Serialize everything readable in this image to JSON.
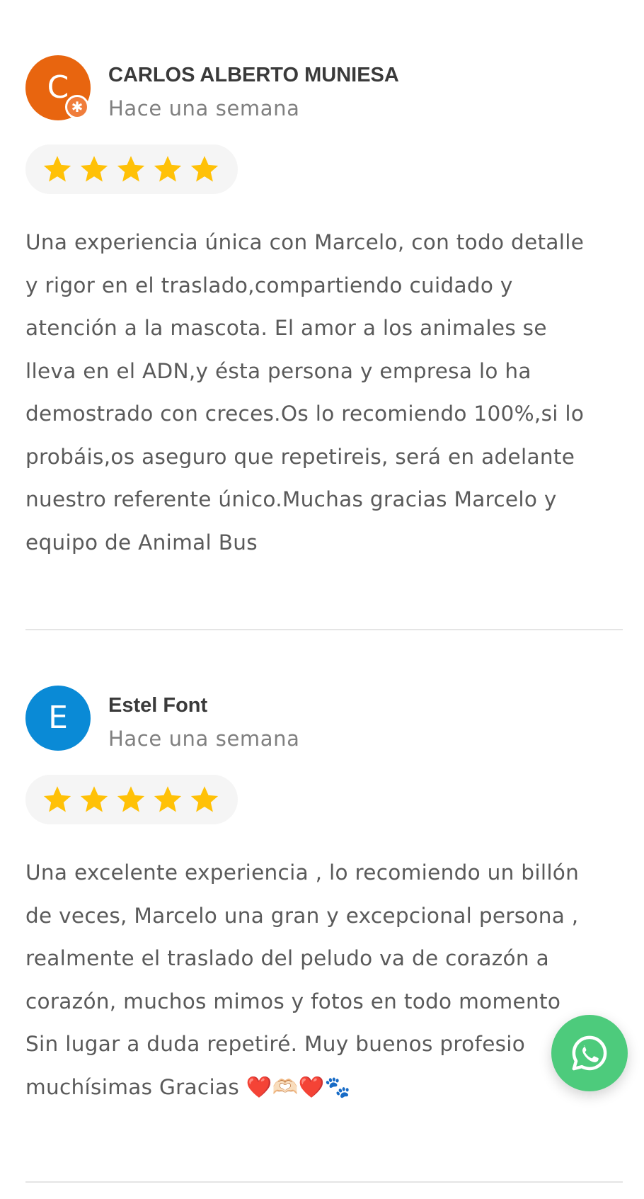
{
  "reviews": [
    {
      "avatar_letter": "C",
      "avatar_color": "#e8650f",
      "badge_symbol": "✱",
      "name": "CARLOS ALBERTO MUNIESA",
      "time": "Hace una semana",
      "rating": 5,
      "text": "Una experiencia única con Marcelo, con todo detalle\ny rigor en el traslado,compartiendo cuidado y\natención a la mascota. El amor a los animales se\nlleva en el ADN,y ésta persona y empresa lo ha\ndemostrado con creces.Os lo recomiendo 100%,si lo\nprobáis,os aseguro que repetireis, será en adelante\nnuestro referente único.Muchas gracias Marcelo y\nequipo de Animal Bus"
    },
    {
      "avatar_letter": "E",
      "avatar_color": "#0a8ad6",
      "name": "Estel Font",
      "time": "Hace una semana",
      "rating": 5,
      "text": "Una excelente experiencia , lo recomiendo un billón\nde veces, Marcelo una gran y excepcional persona ,\nrealmente el traslado del peludo va de corazón a\ncorazón, muchos mimos y fotos en todo momento\nSin lugar a duda repetiré. Muy buenos profesio\nmuchísimas Gracias ❤️🫶🏻❤️🐾"
    }
  ],
  "colors": {
    "star": "#ffc107",
    "whatsapp": "#4dcb7c"
  },
  "icons": {
    "star": "star-icon",
    "whatsapp": "whatsapp-icon",
    "verified_badge": "local-guide-badge-icon"
  }
}
